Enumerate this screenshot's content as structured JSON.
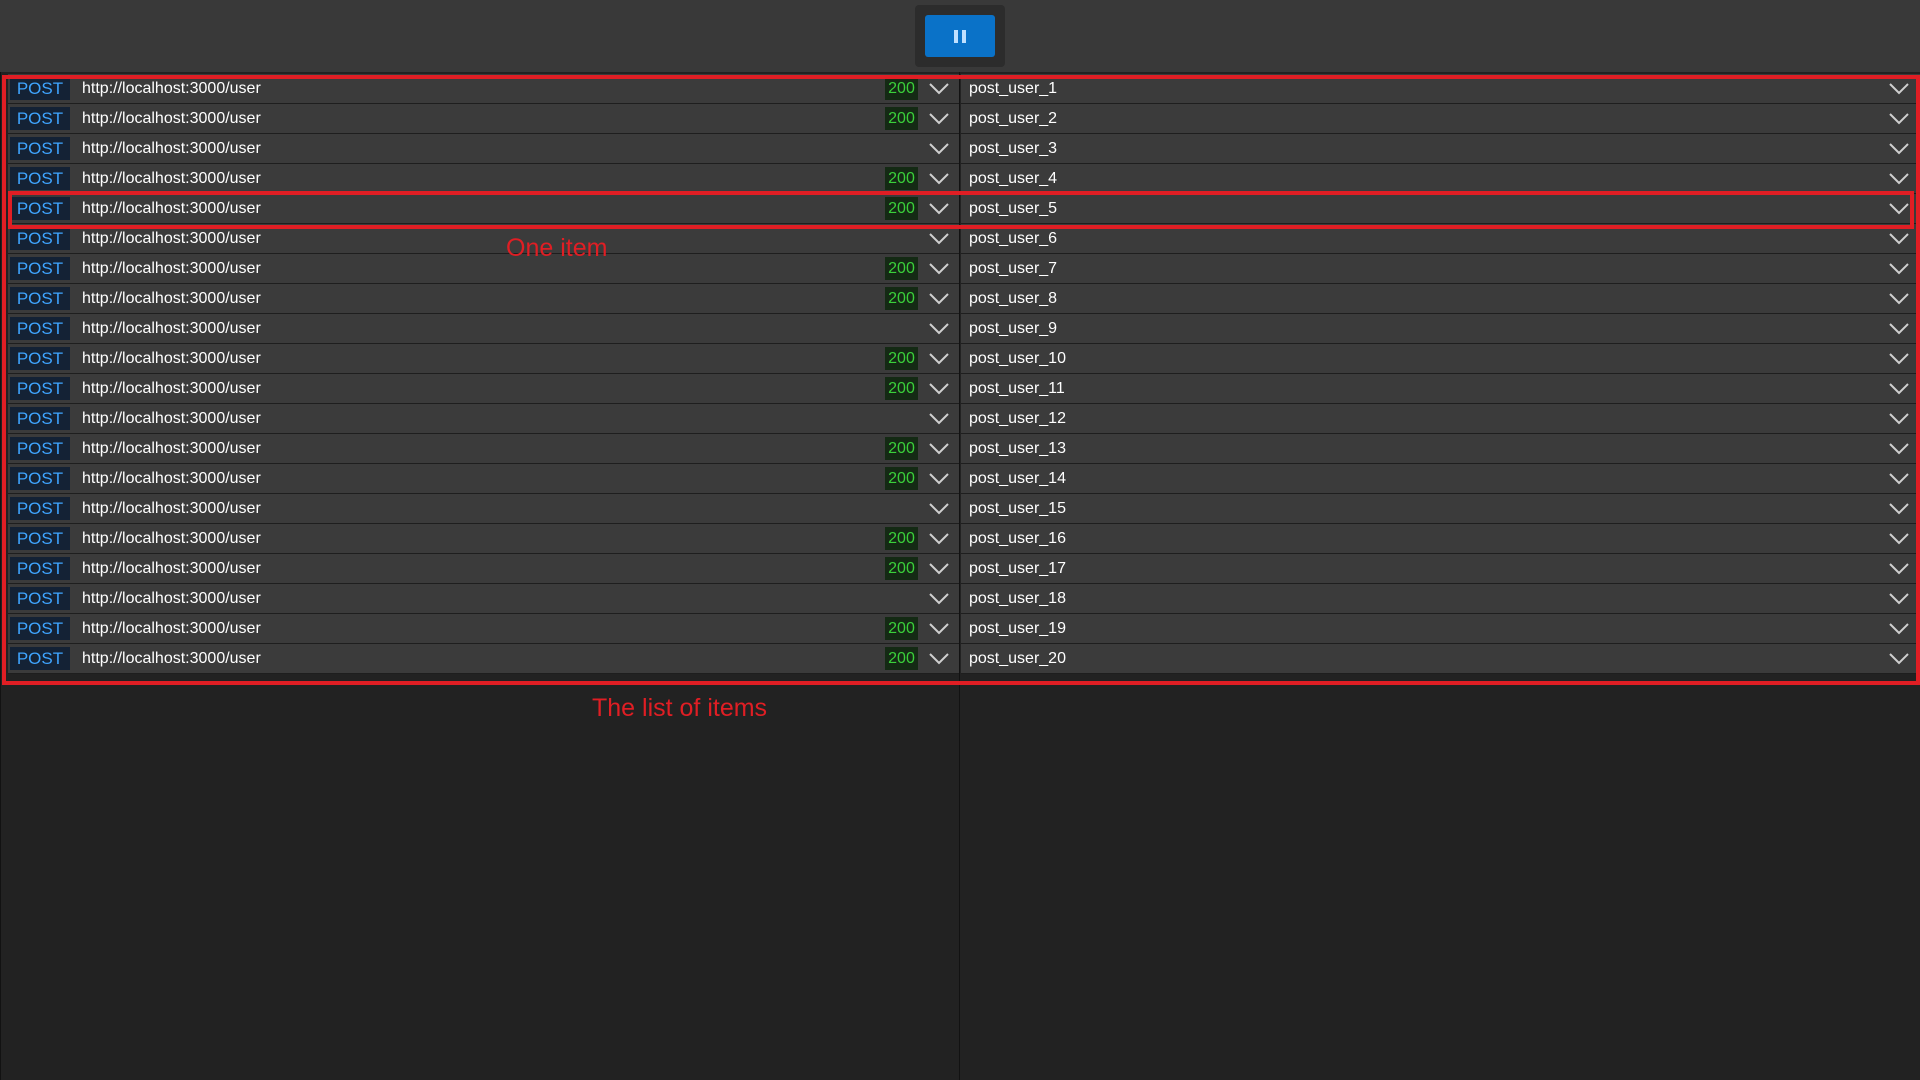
{
  "toolbar": {
    "pause_icon": "pause-icon",
    "accent": "#0a72c8"
  },
  "colors": {
    "method_text": "#3fa5ff",
    "status_text": "#3ad03a",
    "annotation": "#e01e24"
  },
  "requests": [
    {
      "method": "POST",
      "url": "http://localhost:3000/user",
      "status": "200",
      "name": "post_user_1"
    },
    {
      "method": "POST",
      "url": "http://localhost:3000/user",
      "status": "200",
      "name": "post_user_2"
    },
    {
      "method": "POST",
      "url": "http://localhost:3000/user",
      "status": "",
      "name": "post_user_3"
    },
    {
      "method": "POST",
      "url": "http://localhost:3000/user",
      "status": "200",
      "name": "post_user_4"
    },
    {
      "method": "POST",
      "url": "http://localhost:3000/user",
      "status": "200",
      "name": "post_user_5"
    },
    {
      "method": "POST",
      "url": "http://localhost:3000/user",
      "status": "",
      "name": "post_user_6"
    },
    {
      "method": "POST",
      "url": "http://localhost:3000/user",
      "status": "200",
      "name": "post_user_7"
    },
    {
      "method": "POST",
      "url": "http://localhost:3000/user",
      "status": "200",
      "name": "post_user_8"
    },
    {
      "method": "POST",
      "url": "http://localhost:3000/user",
      "status": "",
      "name": "post_user_9"
    },
    {
      "method": "POST",
      "url": "http://localhost:3000/user",
      "status": "200",
      "name": "post_user_10"
    },
    {
      "method": "POST",
      "url": "http://localhost:3000/user",
      "status": "200",
      "name": "post_user_11"
    },
    {
      "method": "POST",
      "url": "http://localhost:3000/user",
      "status": "",
      "name": "post_user_12"
    },
    {
      "method": "POST",
      "url": "http://localhost:3000/user",
      "status": "200",
      "name": "post_user_13"
    },
    {
      "method": "POST",
      "url": "http://localhost:3000/user",
      "status": "200",
      "name": "post_user_14"
    },
    {
      "method": "POST",
      "url": "http://localhost:3000/user",
      "status": "",
      "name": "post_user_15"
    },
    {
      "method": "POST",
      "url": "http://localhost:3000/user",
      "status": "200",
      "name": "post_user_16"
    },
    {
      "method": "POST",
      "url": "http://localhost:3000/user",
      "status": "200",
      "name": "post_user_17"
    },
    {
      "method": "POST",
      "url": "http://localhost:3000/user",
      "status": "",
      "name": "post_user_18"
    },
    {
      "method": "POST",
      "url": "http://localhost:3000/user",
      "status": "200",
      "name": "post_user_19"
    },
    {
      "method": "POST",
      "url": "http://localhost:3000/user",
      "status": "200",
      "name": "post_user_20"
    }
  ],
  "annotations": {
    "item": "One item",
    "list": "The list of items"
  }
}
